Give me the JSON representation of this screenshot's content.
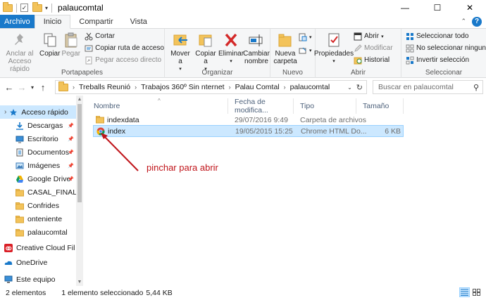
{
  "window": {
    "title": "palaucomtal",
    "minimize": "—",
    "maximize": "☐",
    "close": "✕"
  },
  "tabs": [
    {
      "label": "Archivo"
    },
    {
      "label": "Inicio"
    },
    {
      "label": "Compartir"
    },
    {
      "label": "Vista"
    }
  ],
  "ribbon": {
    "portapapeles": {
      "label": "Portapapeles",
      "pin": "Anclar al Acceso rápido",
      "copy": "Copiar",
      "paste": "Pegar",
      "cut": "Cortar",
      "copy_path": "Copiar ruta de acceso",
      "paste_shortcut": "Pegar acceso directo"
    },
    "organizar": {
      "label": "Organizar",
      "move": "Mover a",
      "copy_to": "Copiar a",
      "delete": "Eliminar",
      "rename": "Cambiar nombre"
    },
    "nuevo": {
      "label": "Nuevo",
      "new_folder": "Nueva carpeta"
    },
    "abrir": {
      "label": "Abrir",
      "properties": "Propiedades",
      "open": "Abrir",
      "modify": "Modificar",
      "history": "Historial"
    },
    "seleccionar": {
      "label": "Seleccionar",
      "select_all": "Seleccionar todo",
      "select_none": "No seleccionar ninguno",
      "invert": "Invertir selección"
    }
  },
  "address": {
    "crumbs": [
      "Treballs Reunió",
      "Trabajos 360º Sin nternet",
      "Palau Comtal",
      "palaucomtal"
    ],
    "search_placeholder": "Buscar en palaucomtal"
  },
  "nav": {
    "items": [
      {
        "label": "Acceso rápido",
        "icon": "star-icon",
        "pinned": false
      },
      {
        "label": "Descargas",
        "icon": "download-icon",
        "pinned": true
      },
      {
        "label": "Escritorio",
        "icon": "desktop-icon",
        "pinned": true
      },
      {
        "label": "Documentos",
        "icon": "documents-icon",
        "pinned": true
      },
      {
        "label": "Imágenes",
        "icon": "pictures-icon",
        "pinned": true
      },
      {
        "label": "Google Drive",
        "icon": "google-drive-icon",
        "pinned": true
      },
      {
        "label": "CASAL_FINAL_a_",
        "icon": "folder-icon",
        "pinned": false
      },
      {
        "label": "Confrides",
        "icon": "folder-icon",
        "pinned": false
      },
      {
        "label": "onteniente",
        "icon": "folder-icon",
        "pinned": false
      },
      {
        "label": "palaucomtal",
        "icon": "folder-icon",
        "pinned": false
      },
      {
        "label": "Creative Cloud Fil",
        "icon": "creative-cloud-icon",
        "pinned": false
      },
      {
        "label": "OneDrive",
        "icon": "onedrive-icon",
        "pinned": false
      },
      {
        "label": "Este equipo",
        "icon": "computer-icon",
        "pinned": false
      }
    ]
  },
  "columns": {
    "name": "Nombre",
    "date": "Fecha de modifica...",
    "type": "Tipo",
    "size": "Tamaño"
  },
  "files": [
    {
      "name": "indexdata",
      "date": "29/07/2016 9:49",
      "type": "Carpeta de archivos",
      "size": "",
      "icon": "folder-icon",
      "selected": false
    },
    {
      "name": "index",
      "date": "19/05/2015 15:25",
      "type": "Chrome HTML Do...",
      "size": "6 KB",
      "icon": "chrome-icon",
      "selected": true
    }
  ],
  "annotation": {
    "text": "pinchar para abrir",
    "color": "#c0141a"
  },
  "status": {
    "count": "2 elementos",
    "selection": "1 elemento seleccionado",
    "size": "5,44 KB"
  },
  "colors": {
    "accent": "#1979ca",
    "selection": "#cce8ff",
    "selection_border": "#99d1ff",
    "folder": "#f3c35a"
  }
}
